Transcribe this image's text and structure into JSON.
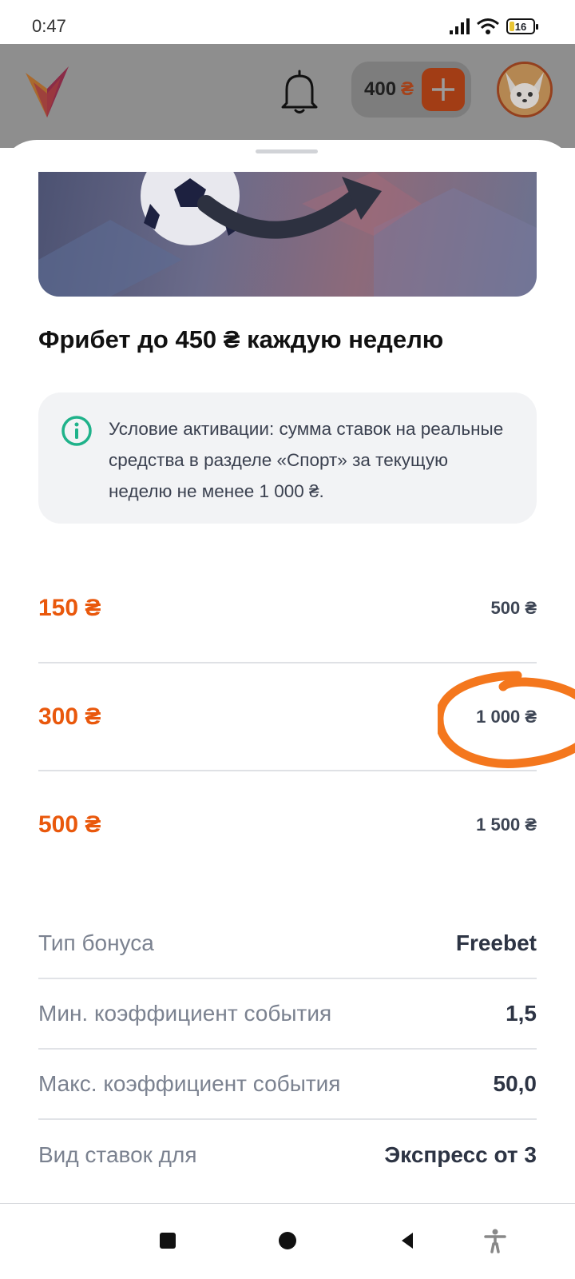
{
  "status_bar": {
    "time": "0:47",
    "battery": "16",
    "icons": [
      "signal-icon",
      "wifi-icon",
      "battery-icon"
    ]
  },
  "header": {
    "logo": "app-logo",
    "notification_icon": "bell-icon",
    "balance_amount": "400",
    "balance_currency": "₴",
    "add_icon": "plus-icon",
    "avatar": "fox-avatar"
  },
  "bonus": {
    "title": "Фрибет до 450 ₴ каждую неделю",
    "info_icon": "info-icon",
    "info_text": "Условие активации: сумма ставок на реальные средства в разделе «Спорт» за текущую неделю не менее 1 000 ₴.",
    "tiers": [
      {
        "bonus": "150 ₴",
        "requirement": "500 ₴"
      },
      {
        "bonus": "300 ₴",
        "requirement": "1 000 ₴"
      },
      {
        "bonus": "500 ₴",
        "requirement": "1 500 ₴"
      }
    ],
    "details": [
      {
        "label": "Тип бонуса",
        "value": "Freebet"
      },
      {
        "label": "Мин. коэффициент события",
        "value": "1,5"
      },
      {
        "label": "Макс. коэффициент события",
        "value": "50,0"
      },
      {
        "label": "Вид ставок для",
        "value": "Экспресс от 3"
      }
    ]
  },
  "nav_bar": {
    "buttons": [
      "recents-square-icon",
      "home-circle-icon",
      "back-triangle-icon",
      "accessibility-icon"
    ]
  },
  "colors": {
    "accent_orange": "#e9580c",
    "annotation_orange": "#f4771d",
    "info_green": "#1fb28a",
    "card_bg": "#f2f3f5"
  }
}
